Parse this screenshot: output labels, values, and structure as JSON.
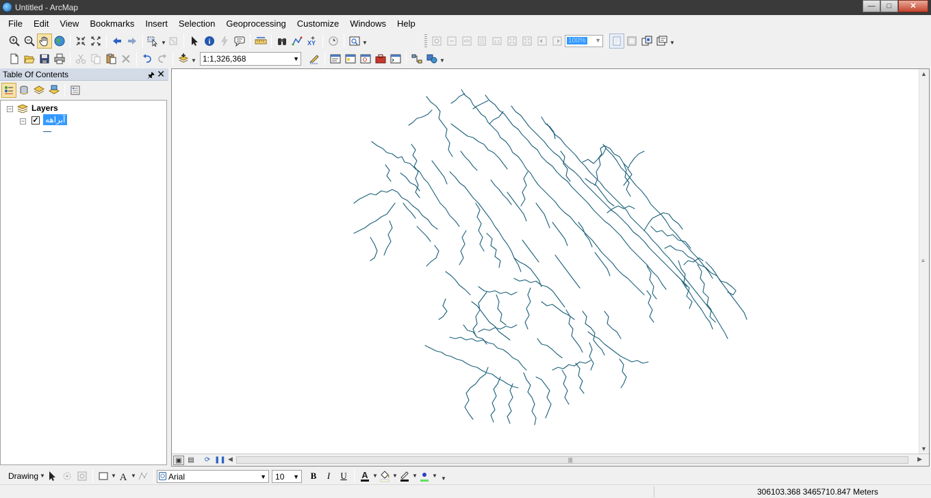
{
  "window": {
    "title": "Untitled - ArcMap",
    "minimize": "—",
    "maximize": "□",
    "close": "✕"
  },
  "menu": [
    "File",
    "Edit",
    "View",
    "Bookmarks",
    "Insert",
    "Selection",
    "Geoprocessing",
    "Customize",
    "Windows",
    "Help"
  ],
  "toolbar": {
    "scale": "1:1,326,368",
    "layout_zoom": "100%"
  },
  "toc": {
    "title": "Table Of Contents",
    "pin": "█",
    "close": "✕",
    "root_label": "Layers",
    "layer_name": "آبراهه",
    "layer_checked": true
  },
  "drawing": {
    "label": "Drawing",
    "font_name": "Arial",
    "font_size": "10",
    "bold": "B",
    "italic": "I",
    "underline": "U",
    "font_color_letter": "A"
  },
  "status": {
    "coordinates": "306103.368  3465710.847 Meters"
  },
  "colors": {
    "river": "#1a5f7a",
    "selection": "#3399ff",
    "toc_header": "#d3dbe7"
  },
  "icons": {
    "zoom_in": "zoom-in-icon",
    "zoom_out": "zoom-out-icon",
    "pan": "pan-hand-icon",
    "full_extent": "globe-icon",
    "identify": "identify-icon",
    "select": "select-arrow-icon"
  }
}
